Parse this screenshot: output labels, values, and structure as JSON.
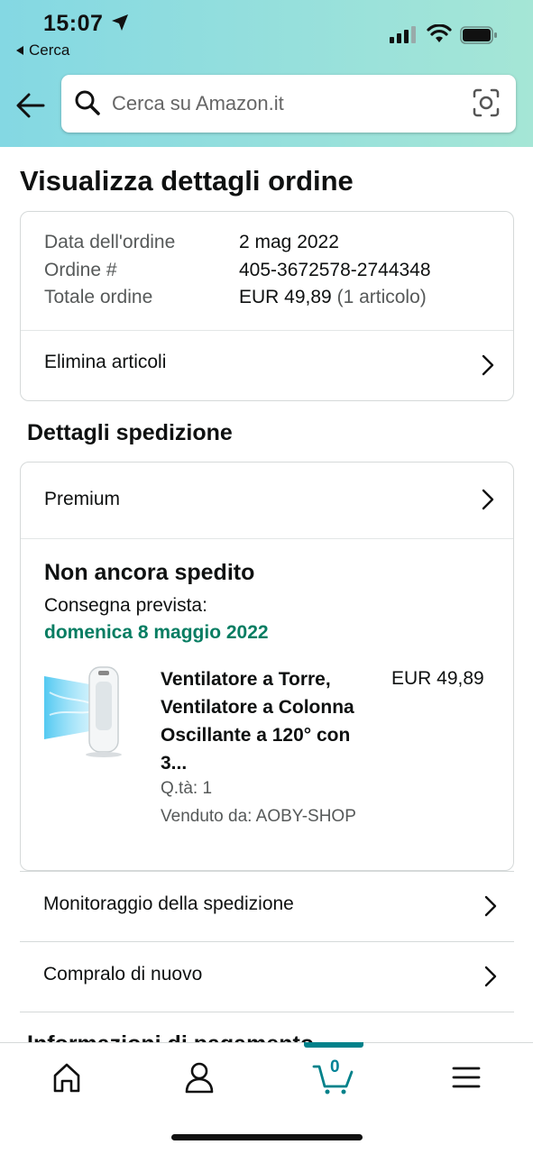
{
  "status_bar": {
    "time": "15:07",
    "back_app": "Cerca"
  },
  "search": {
    "placeholder": "Cerca su Amazon.it"
  },
  "page": {
    "title": "Visualizza dettagli ordine"
  },
  "order_summary": {
    "date_label": "Data dell'ordine",
    "date_value": "2 mag 2022",
    "number_label": "Ordine #",
    "number_value": "405-3672578-2744348",
    "total_label": "Totale ordine",
    "total_value": "EUR 49,89",
    "total_items": "(1 articolo)",
    "delete_items": "Elimina articoli"
  },
  "shipping": {
    "section_title": "Dettagli spedizione",
    "method": "Premium",
    "status": "Non ancora spedito",
    "delivery_label": "Consegna prevista:",
    "delivery_date": "domenica 8 maggio 2022",
    "status_color": "#067d62"
  },
  "product": {
    "title": "Ventilatore a Torre, Ventilatore a Colonna Oscillante a 120° con 3...",
    "price": "EUR 49,89",
    "quantity": "Q.tà: 1",
    "seller": "Venduto da: AOBY-SHOP"
  },
  "actions": {
    "track": "Monitoraggio della spedizione",
    "buy_again": "Compralo di nuovo"
  },
  "next_section": {
    "title": "Informazioni di pagamento"
  },
  "tab_bar": {
    "cart_count": "0",
    "accent_color": "#00818a"
  }
}
